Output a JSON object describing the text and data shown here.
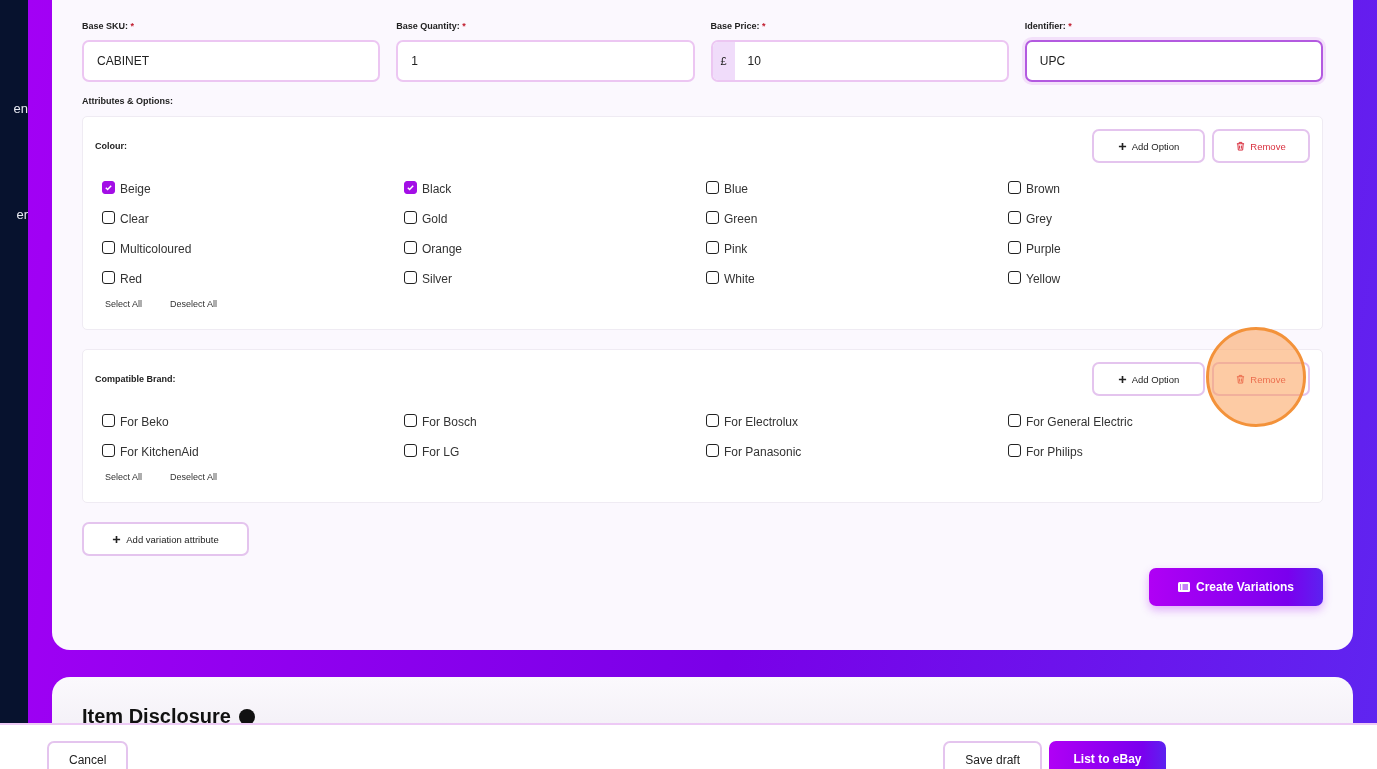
{
  "sidebar": {
    "items": [
      {
        "label": "en"
      },
      {
        "label": "er"
      }
    ]
  },
  "fields": [
    {
      "label": "Base SKU:",
      "required_mark": "*",
      "value": "CABINET",
      "focused": false
    },
    {
      "label": "Base Quantity:",
      "required_mark": "*",
      "value": "1",
      "focused": false
    },
    {
      "label": "Base Price:",
      "required_mark": "*",
      "prefix": "£",
      "value": "10",
      "focused": false
    },
    {
      "label": "Identifier:",
      "required_mark": "*",
      "value": "UPC",
      "focused": true
    }
  ],
  "attributes_label": "Attributes & Options:",
  "attributes": [
    {
      "name": "Colour:",
      "add_label": "Add Option",
      "remove_label": "Remove",
      "highlighted": false,
      "select_all": "Select All",
      "deselect_all": "Deselect All",
      "options": [
        {
          "label": "Beige",
          "checked": true
        },
        {
          "label": "Black",
          "checked": true
        },
        {
          "label": "Blue",
          "checked": false
        },
        {
          "label": "Brown",
          "checked": false
        },
        {
          "label": "Clear",
          "checked": false
        },
        {
          "label": "Gold",
          "checked": false
        },
        {
          "label": "Green",
          "checked": false
        },
        {
          "label": "Grey",
          "checked": false
        },
        {
          "label": "Multicoloured",
          "checked": false
        },
        {
          "label": "Orange",
          "checked": false
        },
        {
          "label": "Pink",
          "checked": false
        },
        {
          "label": "Purple",
          "checked": false
        },
        {
          "label": "Red",
          "checked": false
        },
        {
          "label": "Silver",
          "checked": false
        },
        {
          "label": "White",
          "checked": false
        },
        {
          "label": "Yellow",
          "checked": false
        }
      ]
    },
    {
      "name": "Compatible Brand:",
      "add_label": "Add Option",
      "remove_label": "Remove",
      "highlighted": true,
      "select_all": "Select All",
      "deselect_all": "Deselect All",
      "options": [
        {
          "label": "For Beko",
          "checked": false
        },
        {
          "label": "For Bosch",
          "checked": false
        },
        {
          "label": "For Electrolux",
          "checked": false
        },
        {
          "label": "For General Electric",
          "checked": false
        },
        {
          "label": "For KitchenAid",
          "checked": false
        },
        {
          "label": "For LG",
          "checked": false
        },
        {
          "label": "For Panasonic",
          "checked": false
        },
        {
          "label": "For Philips",
          "checked": false
        }
      ]
    }
  ],
  "add_attribute_button": "Add variation attribute",
  "create_button": "Create Variations",
  "next_section": {
    "title": "Item Disclosure"
  },
  "footer": {
    "cancel": "Cancel",
    "save": "Save draft",
    "submit": "List to eBay"
  }
}
